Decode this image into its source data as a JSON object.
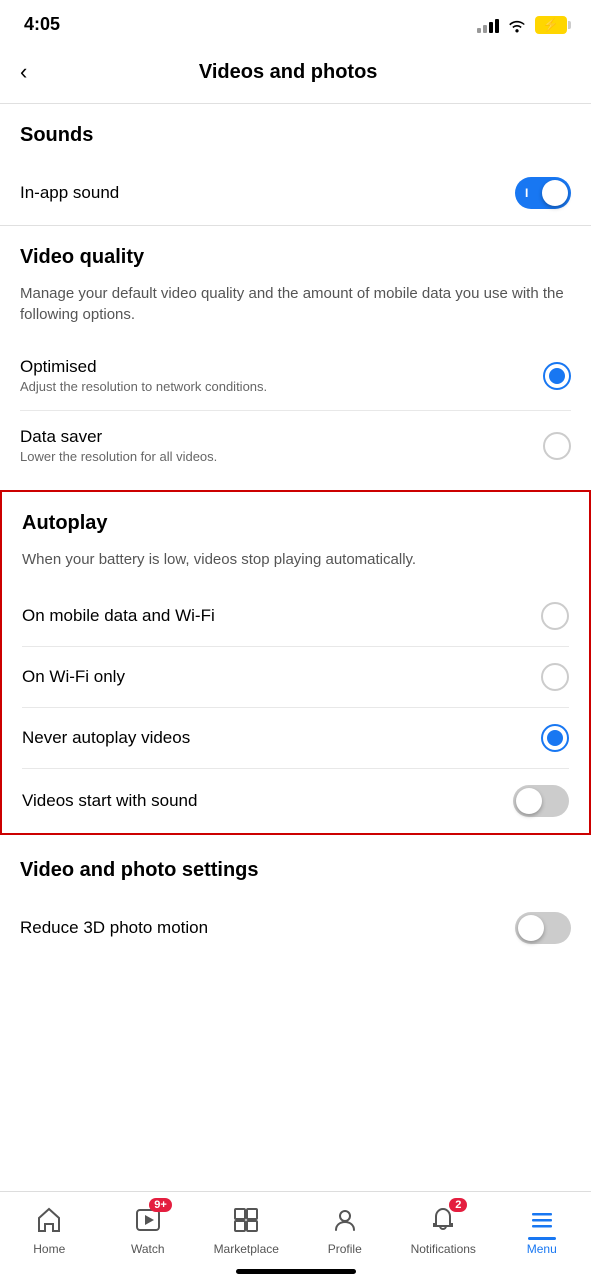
{
  "statusBar": {
    "time": "4:05",
    "battery": "⚡"
  },
  "header": {
    "backLabel": "‹",
    "title": "Videos and photos"
  },
  "sounds": {
    "sectionTitle": "Sounds",
    "inAppSound": {
      "label": "In-app sound",
      "enabled": true
    }
  },
  "videoQuality": {
    "sectionTitle": "Video quality",
    "description": "Manage your default video quality and the amount of mobile data you use with the following options.",
    "options": [
      {
        "label": "Optimised",
        "sublabel": "Adjust the resolution to network conditions.",
        "selected": true
      },
      {
        "label": "Data saver",
        "sublabel": "Lower the resolution for all videos.",
        "selected": false
      }
    ]
  },
  "autoplay": {
    "sectionTitle": "Autoplay",
    "description": "When your battery is low, videos stop playing automatically.",
    "options": [
      {
        "label": "On mobile data and Wi-Fi",
        "selected": false
      },
      {
        "label": "On Wi-Fi only",
        "selected": false
      },
      {
        "label": "Never autoplay videos",
        "selected": true
      }
    ],
    "videosStartWithSound": {
      "label": "Videos start with sound",
      "enabled": false
    }
  },
  "videoPhotoSettings": {
    "sectionTitle": "Video and photo settings",
    "reduce3DPhotoMotion": {
      "label": "Reduce 3D photo motion",
      "enabled": false
    }
  },
  "bottomNav": {
    "items": [
      {
        "id": "home",
        "label": "Home",
        "icon": "⌂",
        "badge": null,
        "active": false
      },
      {
        "id": "watch",
        "label": "Watch",
        "icon": "▶",
        "badge": "9+",
        "active": false
      },
      {
        "id": "marketplace",
        "label": "Marketplace",
        "icon": "⊞",
        "badge": null,
        "active": false
      },
      {
        "id": "profile",
        "label": "Profile",
        "icon": "◉",
        "badge": null,
        "active": false
      },
      {
        "id": "notifications",
        "label": "Notifications",
        "icon": "🔔",
        "badge": "2",
        "active": false
      },
      {
        "id": "menu",
        "label": "Menu",
        "icon": "≡",
        "badge": null,
        "active": true
      }
    ]
  }
}
